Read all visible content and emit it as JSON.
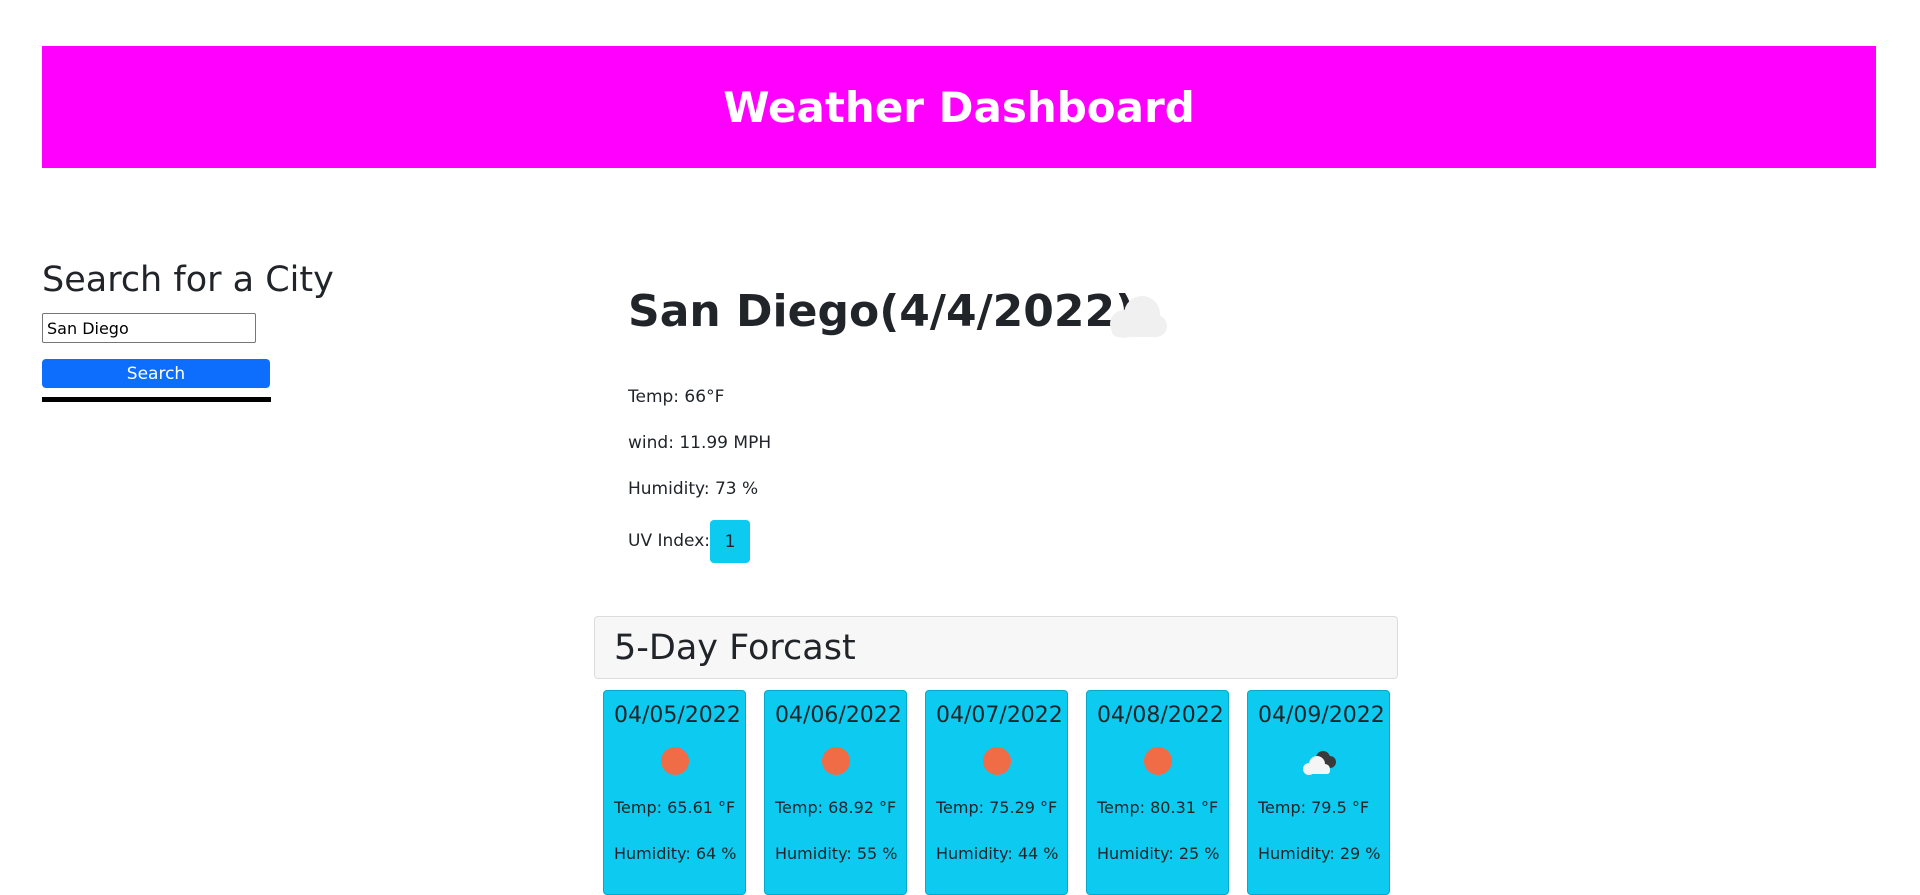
{
  "header": {
    "title": "Weather Dashboard"
  },
  "search": {
    "heading": "Search for a City",
    "input_value": "San Diego",
    "button_label": "Search"
  },
  "current": {
    "title": "San Diego(4/4/2022)",
    "icon": "cloud-icon",
    "temp": "Temp: 66°F",
    "wind": "wind: 11.99 MPH",
    "humidity": "Humidity: 73 %",
    "uv_label": "UV Index:",
    "uv_value": "1"
  },
  "forecast": {
    "title": "5-Day Forcast",
    "days": [
      {
        "date": "04/05/2022",
        "icon": "sun-icon",
        "temp": "Temp: 65.61 °F",
        "humidity": "Humidity: 64 %"
      },
      {
        "date": "04/06/2022",
        "icon": "sun-icon",
        "temp": "Temp: 68.92 °F",
        "humidity": "Humidity: 55 %"
      },
      {
        "date": "04/07/2022",
        "icon": "sun-icon",
        "temp": "Temp: 75.29 °F",
        "humidity": "Humidity: 44 %"
      },
      {
        "date": "04/08/2022",
        "icon": "sun-icon",
        "temp": "Temp: 80.31 °F",
        "humidity": "Humidity: 25 %"
      },
      {
        "date": "04/09/2022",
        "icon": "broken-clouds-icon",
        "temp": "Temp: 79.5 °F",
        "humidity": "Humidity: 29 %"
      }
    ]
  },
  "colors": {
    "banner": "#ff00ff",
    "search_button": "#0d6efd",
    "card": "#0dcaf0",
    "sun": "#ef6c47"
  }
}
